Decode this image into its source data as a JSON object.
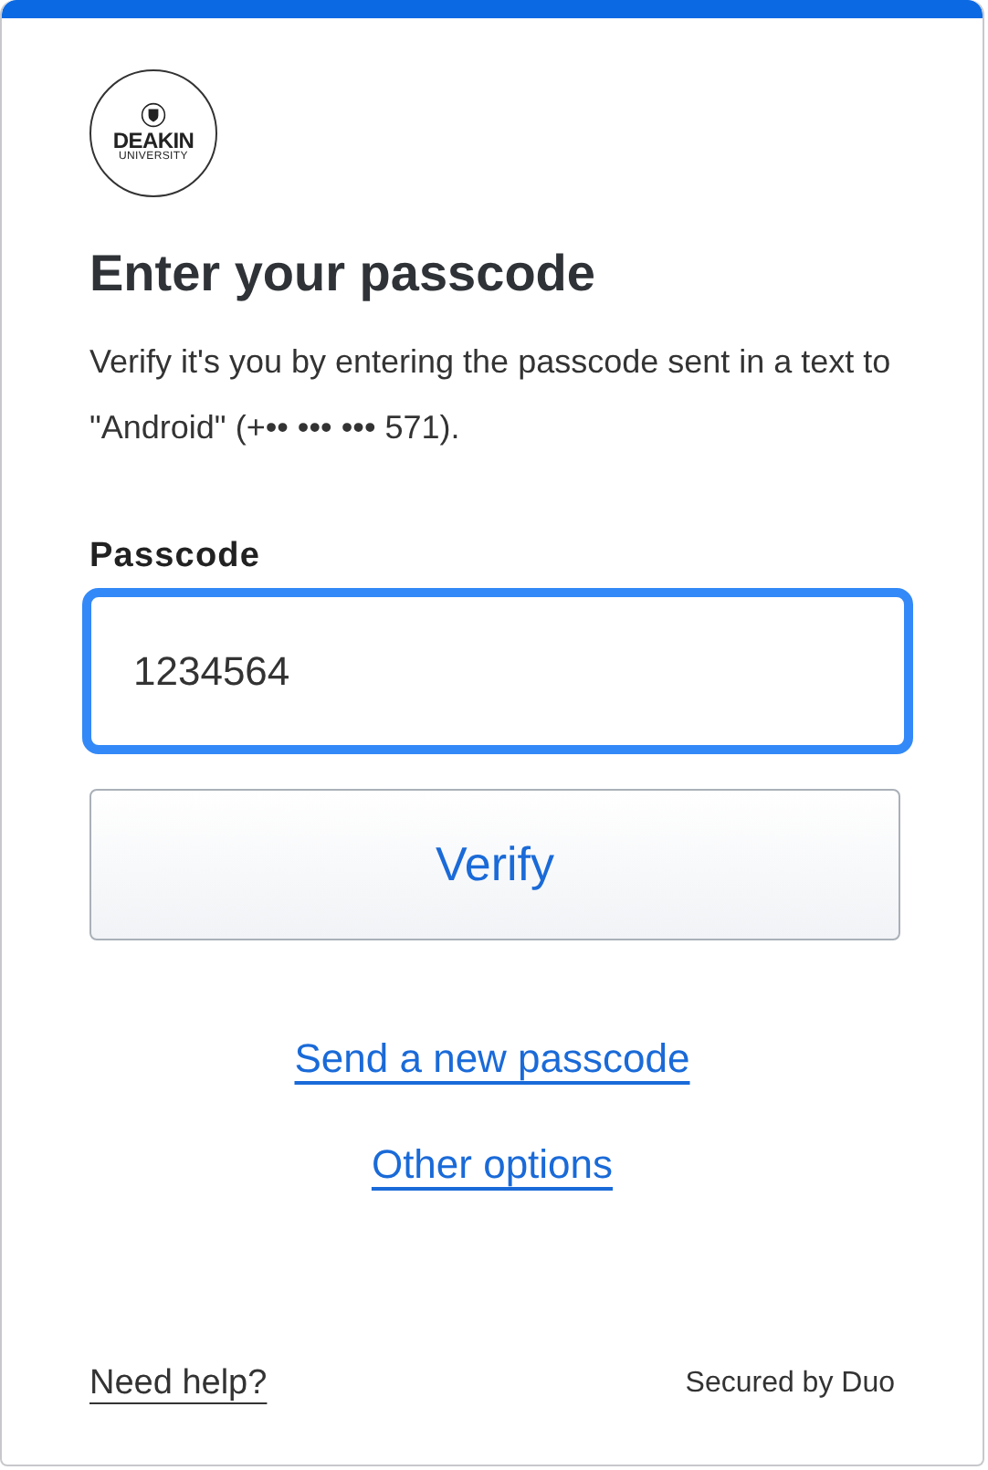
{
  "logo": {
    "name": "DEAKIN",
    "subtitle": "UNIVERSITY"
  },
  "title": "Enter your passcode",
  "description": "Verify it's you by entering the passcode sent in a text to \"Android\" (+•• ••• ••• 571).",
  "passcode_field": {
    "label": "Passcode",
    "value": "1234564",
    "focused": true
  },
  "verify_button": "Verify",
  "links": [
    "Send a new passcode",
    "Other options"
  ],
  "footer": {
    "help_link": "Need help?",
    "secured_by": "Secured by Duo"
  }
}
